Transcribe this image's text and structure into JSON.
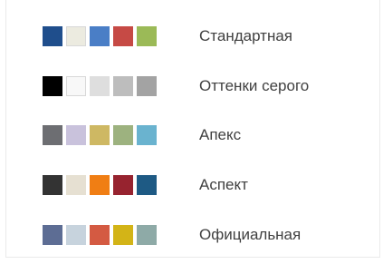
{
  "themes": [
    {
      "name": "Стандартная",
      "colors": [
        "#1f4e8c",
        "#ecebe0",
        "#4a7ec6",
        "#c64a45",
        "#9bba57"
      ]
    },
    {
      "name": "Оттенки серого",
      "colors": [
        "#000000",
        "#f8f8f8",
        "#dedede",
        "#bdbdbd",
        "#a3a3a3"
      ]
    },
    {
      "name": "Апекс",
      "colors": [
        "#6d6e72",
        "#c9c2dc",
        "#ceb863",
        "#9db27f",
        "#6ab3cf"
      ]
    },
    {
      "name": "Аспект",
      "colors": [
        "#333333",
        "#e6e0d2",
        "#f07e14",
        "#97232f",
        "#1e5a84"
      ]
    },
    {
      "name": "Официальная",
      "colors": [
        "#5d6d94",
        "#c7d3dd",
        "#d45a42",
        "#d3b417",
        "#8eaaa7"
      ]
    }
  ]
}
